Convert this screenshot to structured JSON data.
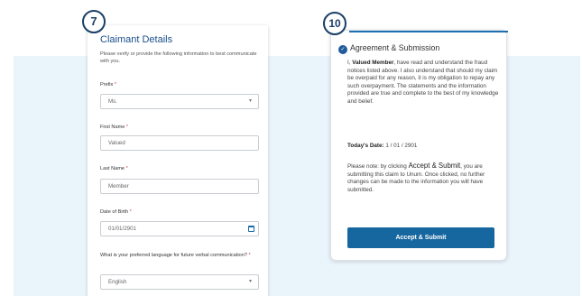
{
  "step_left": "7",
  "step_right": "10",
  "form": {
    "title": "Claimant Details",
    "instructions": "Please verify or provide the following information to best communicate with you.",
    "prefix_label": "Prefix",
    "prefix_value": "Ms.",
    "first_name_label": "First Name",
    "first_name_value": "Valued",
    "last_name_label": "Last Name",
    "last_name_value": "Member",
    "dob_label": "Date of Birth",
    "dob_value": "01/01/2901",
    "language_label": "What is your preferred language for future verbal communication?",
    "language_value": "English",
    "required_mark": "*"
  },
  "agreement": {
    "title": "Agreement & Submission",
    "p1_pre": "I, ",
    "p1_name": "Valued Member",
    "p1_post": ", have read and understand the fraud notices listed above. I also understand that should my claim be overpaid for any reason, it is my obligation to repay any such overpayment. The statements and the information provided are true and complete to the best of my knowledge and belief.",
    "date_label": "Today's Date:",
    "date_value": " 1 / 01 / 2901",
    "note_pre": "Please note: by clicking ",
    "note_accept": "Accept & Submit",
    "note_post": ", you are submitting this claim to Unum. Once clicked, no further changes can be made to the information you will have submitted.",
    "button_label": "Accept & Submit"
  },
  "icons": {
    "chevron": "chevron-down-icon",
    "calendar": "calendar-icon",
    "check": "check-circle-icon"
  },
  "colors": {
    "brand_blue": "#16669f",
    "band": "#eaf4fb",
    "required": "#d64545"
  }
}
